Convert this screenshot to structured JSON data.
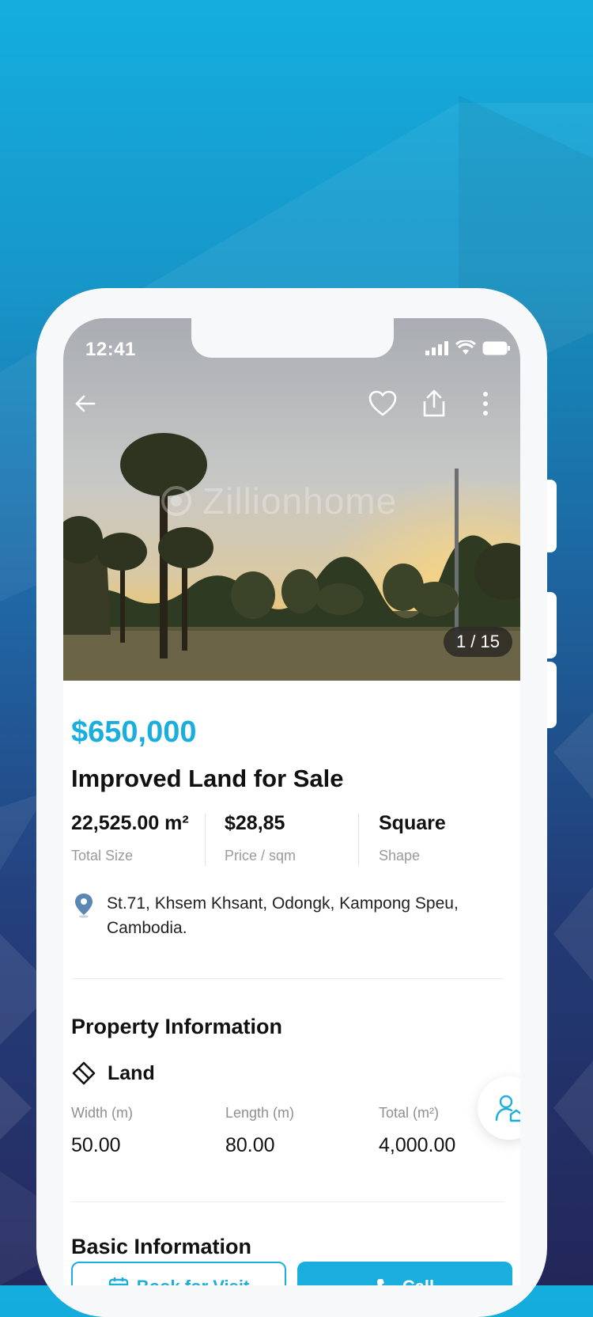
{
  "status_bar": {
    "time": "12:41"
  },
  "gallery": {
    "watermark": "Zillionhome",
    "counter": "1 / 15"
  },
  "listing": {
    "price": "$650,000",
    "title": "Improved Land for Sale",
    "stats": [
      {
        "value": "22,525.00 m²",
        "label": "Total Size"
      },
      {
        "value": "$28,85",
        "label": "Price / sqm"
      },
      {
        "value": "Square",
        "label": "Shape"
      }
    ],
    "address": "St.71, Khsem Khsant, Odongk, Kampong Speu, Cambodia."
  },
  "property_information": {
    "heading": "Property Information",
    "type_label": "Land",
    "dimensions": [
      {
        "label": "Width (m)",
        "value": "50.00"
      },
      {
        "label": "Length (m)",
        "value": "80.00"
      },
      {
        "label": "Total (m²)",
        "value": "4,000.00"
      }
    ]
  },
  "basic_information": {
    "heading": "Basic Information"
  },
  "actions": {
    "book_visit": "Book for Visit",
    "call": "Call"
  },
  "colors": {
    "accent": "#19aede",
    "text": "#111111",
    "muted": "#9a9a9a"
  },
  "icons": [
    "back-arrow-icon",
    "heart-icon",
    "share-icon",
    "more-vertical-icon",
    "location-pin-icon",
    "land-icon",
    "agent-icon",
    "calendar-icon",
    "phone-icon",
    "signal-icon",
    "wifi-icon",
    "battery-icon"
  ]
}
